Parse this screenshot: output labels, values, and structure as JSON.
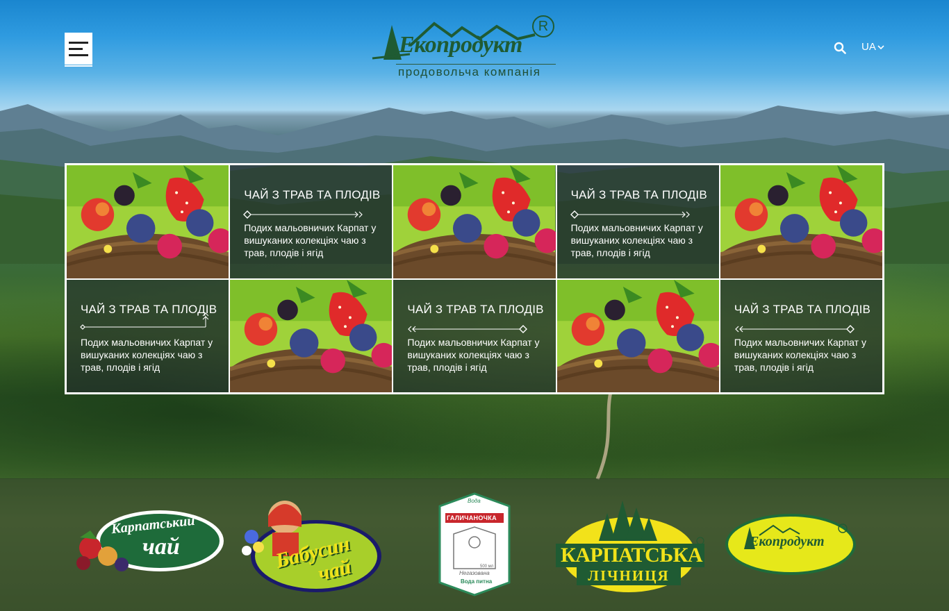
{
  "header": {
    "logo_name": "Екопродукт",
    "logo_reg": "R",
    "logo_tagline": "продовольча компанія",
    "language": "UA"
  },
  "cards": [
    {
      "type": "image"
    },
    {
      "type": "text",
      "title": "ЧАЙ З ТРАВ ТА ПЛОДІВ",
      "desc": "Подих мальовничих Карпат у вишуканих колекціях чаю з трав, плодів і ягід",
      "arrow": "right"
    },
    {
      "type": "image"
    },
    {
      "type": "text",
      "title": "ЧАЙ З ТРАВ ТА ПЛОДІВ",
      "desc": "Подих мальовничих Карпат у вишуканих колекціях чаю з трав, плодів і ягід",
      "arrow": "right"
    },
    {
      "type": "image"
    },
    {
      "type": "text",
      "title": "ЧАЙ З ТРАВ ТА ПЛОДІВ",
      "desc": "Подих мальовничих Карпат у вишуканих колекціях чаю з трав, плодів і ягід",
      "arrow": "up"
    },
    {
      "type": "image"
    },
    {
      "type": "text",
      "title": "ЧАЙ З ТРАВ ТА ПЛОДІВ",
      "desc": "Подих мальовничих Карпат у вишуканих колекціях чаю з трав, плодів і ягід",
      "arrow": "left"
    },
    {
      "type": "image"
    },
    {
      "type": "text",
      "title": "ЧАЙ З ТРАВ ТА ПЛОДІВ",
      "desc": "Подих мальовничих Карпат у вишуканих колекціях чаю з трав, плодів і ягід",
      "arrow": "left"
    }
  ],
  "brands": {
    "karpatskyi_chai": {
      "line1": "Карпатський",
      "line2": "чай"
    },
    "babusyn_chai": {
      "line1": "Бабусин",
      "line2": "чай"
    },
    "halychanochka": {
      "top": "Вода",
      "name": "ГАЛИЧАНОЧКА",
      "sub1": "Негазована",
      "sub2": "Вода питна",
      "volume": "500 мл"
    },
    "karpatska_lichnytsia": {
      "line1": "КАРПАТСЬКА",
      "line2": "ЛІЧНИЦЯ"
    },
    "ekoprodukt": {
      "name": "Екопродукт"
    }
  },
  "colors": {
    "brand_green": "#1f5b33",
    "card_overlay": "rgba(35,45,45,0.62)",
    "yellow": "#f2e21a"
  }
}
